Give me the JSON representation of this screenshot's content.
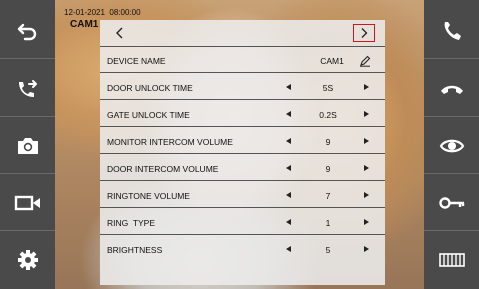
{
  "status": {
    "date": "12-01-2021",
    "time": "08:00:00",
    "camera": "CAM1"
  },
  "left_sidebar": {
    "buttons": [
      {
        "icon": "back-arrow-icon"
      },
      {
        "icon": "transfer-call-icon"
      },
      {
        "icon": "camera-icon"
      },
      {
        "icon": "video-record-icon"
      },
      {
        "icon": "gear-icon"
      }
    ]
  },
  "right_sidebar": {
    "buttons": [
      {
        "icon": "phone-answer-icon"
      },
      {
        "icon": "phone-hangup-icon"
      },
      {
        "icon": "eye-icon"
      },
      {
        "icon": "key-icon"
      },
      {
        "icon": "gate-icon"
      }
    ]
  },
  "settings": {
    "rows": [
      {
        "label": "DEVICE NAME",
        "value": "CAM1"
      },
      {
        "label": "DOOR UNLOCK TIME",
        "value": "5S"
      },
      {
        "label": "GATE UNLOCK TIME",
        "value": "0.2S"
      },
      {
        "label": "MONITOR INTERCOM VOLUME",
        "value": "9"
      },
      {
        "label": "DOOR INTERCOM VOLUME",
        "value": "9"
      },
      {
        "label": "RINGTONE VOLUME",
        "value": "7"
      },
      {
        "label": "RING  TYPE",
        "value": "1"
      },
      {
        "label": "BRIGHTNESS",
        "value": "5"
      }
    ]
  },
  "colors": {
    "sidebar": "#4a4a4a",
    "highlight": "#d0161d"
  }
}
